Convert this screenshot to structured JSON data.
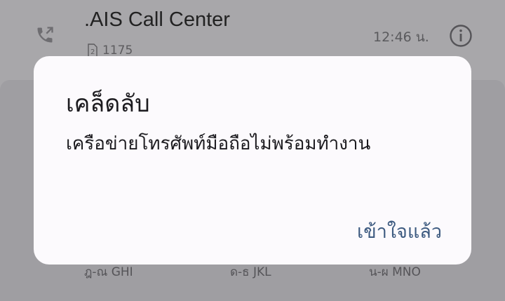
{
  "call_log": {
    "name": ".AIS Call Center",
    "sim_slot": "2",
    "number": "1175",
    "time": "12:46 น."
  },
  "dialpad": {
    "keys": [
      {
        "sub": "ฎ-ณ GHI"
      },
      {
        "sub": "ด-ธ JKL"
      },
      {
        "sub": "น-ผ MNO"
      }
    ]
  },
  "dialog": {
    "title": "เคล็ดลับ",
    "message": "เครือข่ายโทรศัพท์มือถือไม่พร้อมทำงาน",
    "button": "เข้าใจแล้ว"
  },
  "colors": {
    "scrim": "#a8a7aa",
    "dialog_bg": "#fcfafd",
    "accent": "#3d5a80"
  },
  "icons": [
    "outgoing-call-icon",
    "sim-card-icon",
    "info-icon"
  ]
}
